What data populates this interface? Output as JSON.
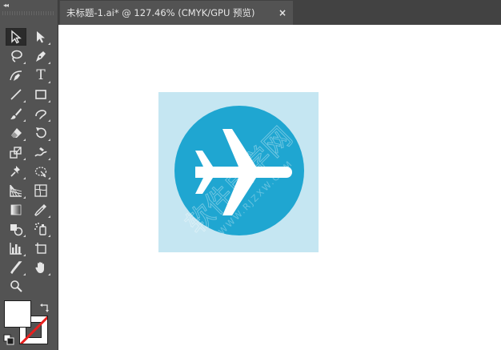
{
  "document_tab": {
    "title": "未标题-1.ai* @ 127.46% (CMYK/GPU 预览)",
    "close_glyph": "×"
  },
  "toolbar": {
    "collapse_glyph": "◂◂",
    "tools": [
      {
        "name": "selection",
        "icon": "arrow-black-icon",
        "active": true
      },
      {
        "name": "direct-selection",
        "icon": "arrow-white-icon"
      },
      {
        "name": "lasso",
        "icon": "lasso-icon"
      },
      {
        "name": "pen",
        "icon": "pen-icon"
      },
      {
        "name": "curvature",
        "icon": "curvature-pen-icon"
      },
      {
        "name": "type",
        "icon": "type-icon",
        "label": "T"
      },
      {
        "name": "line-segment",
        "icon": "line-icon"
      },
      {
        "name": "rectangle",
        "icon": "rectangle-icon"
      },
      {
        "name": "paintbrush",
        "icon": "brush-icon"
      },
      {
        "name": "shaper",
        "icon": "shaper-icon"
      },
      {
        "name": "eraser",
        "icon": "eraser-icon"
      },
      {
        "name": "rotate",
        "icon": "rotate-icon"
      },
      {
        "name": "scale",
        "icon": "scale-icon"
      },
      {
        "name": "warp",
        "icon": "warp-icon"
      },
      {
        "name": "puppet-warp",
        "icon": "pin-icon"
      },
      {
        "name": "free-transform",
        "icon": "free-transform-icon"
      },
      {
        "name": "perspective-grid",
        "icon": "perspective-grid-icon"
      },
      {
        "name": "mesh",
        "icon": "mesh-icon"
      },
      {
        "name": "gradient",
        "icon": "gradient-icon"
      },
      {
        "name": "eyedropper",
        "icon": "eyedropper-icon"
      },
      {
        "name": "blend",
        "icon": "shape-builder-icon"
      },
      {
        "name": "symbol-sprayer",
        "icon": "symbol-sprayer-icon"
      },
      {
        "name": "column-graph",
        "icon": "graph-icon"
      },
      {
        "name": "artboard",
        "icon": "artboard-icon"
      },
      {
        "name": "slice",
        "icon": "slice-icon"
      },
      {
        "name": "hand",
        "icon": "hand-icon"
      },
      {
        "name": "zoom",
        "icon": "zoom-icon"
      }
    ]
  },
  "fill_stroke": {
    "fill_color": "#ffffff",
    "stroke_color": "none",
    "swap_icon": "swap-arrow-icon",
    "default_icon": "default-colors-icon"
  },
  "artwork": {
    "background_color": "#c5e6f2",
    "circle_color": "#1fa6d1",
    "plane_color": "#ffffff",
    "icon": "airplane-icon"
  },
  "watermark": {
    "text": "软件自学网",
    "sub_text": "WWW.RJZXW.COM",
    "color": "#ffffff"
  }
}
